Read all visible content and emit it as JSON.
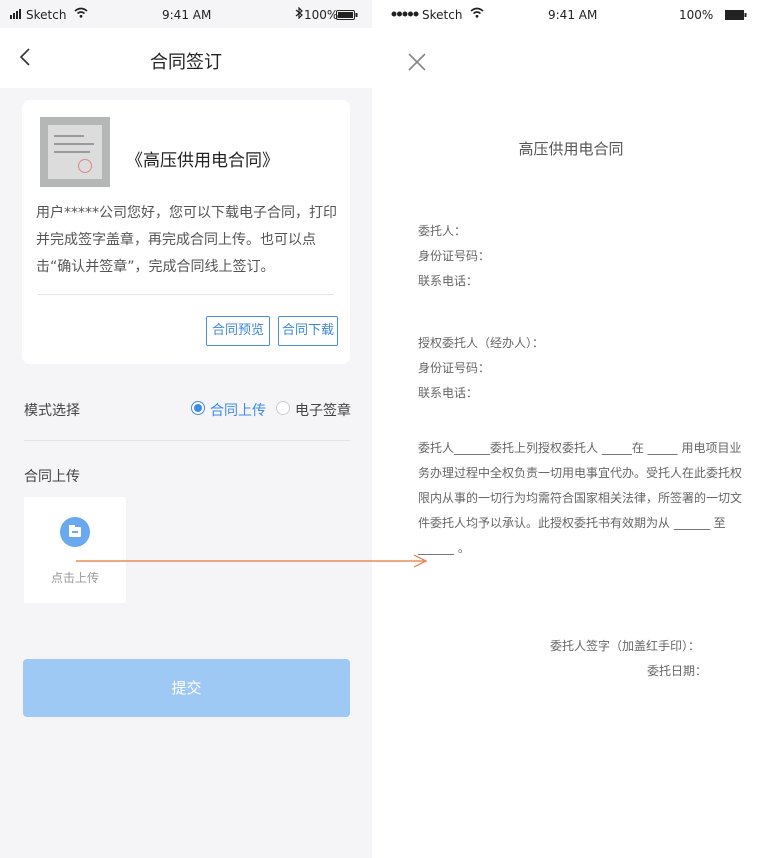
{
  "left_phone": {
    "status": {
      "carrier": "Sketch",
      "time": "9:41 AM",
      "battery": "100%"
    },
    "nav_title": "合同签订",
    "card": {
      "contract_name": "《高压供用电合同》",
      "description": "用户*****公司您好，您可以下载电子合同，打印并完成签字盖章，再完成合同上传。也可以点击“确认并签章”，完成合同线上签订。",
      "preview_label": "合同预览",
      "download_label": "合同下载"
    },
    "mode": {
      "label": "模式选择",
      "options": [
        {
          "label": "合同上传",
          "selected": true
        },
        {
          "label": "电子签章",
          "selected": false
        }
      ]
    },
    "upload": {
      "section_label": "合同上传",
      "tile_label": "点击上传"
    },
    "submit_label": "提交"
  },
  "right_phone": {
    "status": {
      "carrier": "Sketch",
      "time": "9:41 AM",
      "battery": "100%"
    },
    "doc_title": "高压供用电合同",
    "fields_group1": [
      "委托人：",
      "身份证号码：",
      "联系电话："
    ],
    "fields_group2": [
      "授权委托人（经办人）：",
      "身份证号码：",
      "联系电话："
    ],
    "paragraph": "委托人______委托上列授权委托人 _____在 _____ 用电项目业务办理过程中全权负责一切用电事宜代办。受托人在此委托权限内从事的一切行为均需符合国家相关法律，所签署的一切文件委托人均予以承认。此授权委托书有效期为从 ______ 至______ 。",
    "signature_label": "委托人签字（加盖红手印）：",
    "date_label": "委托日期："
  },
  "colors": {
    "accent": "#3d8bef",
    "submit": "#9ec9f4",
    "arrow": "#e8733c"
  }
}
